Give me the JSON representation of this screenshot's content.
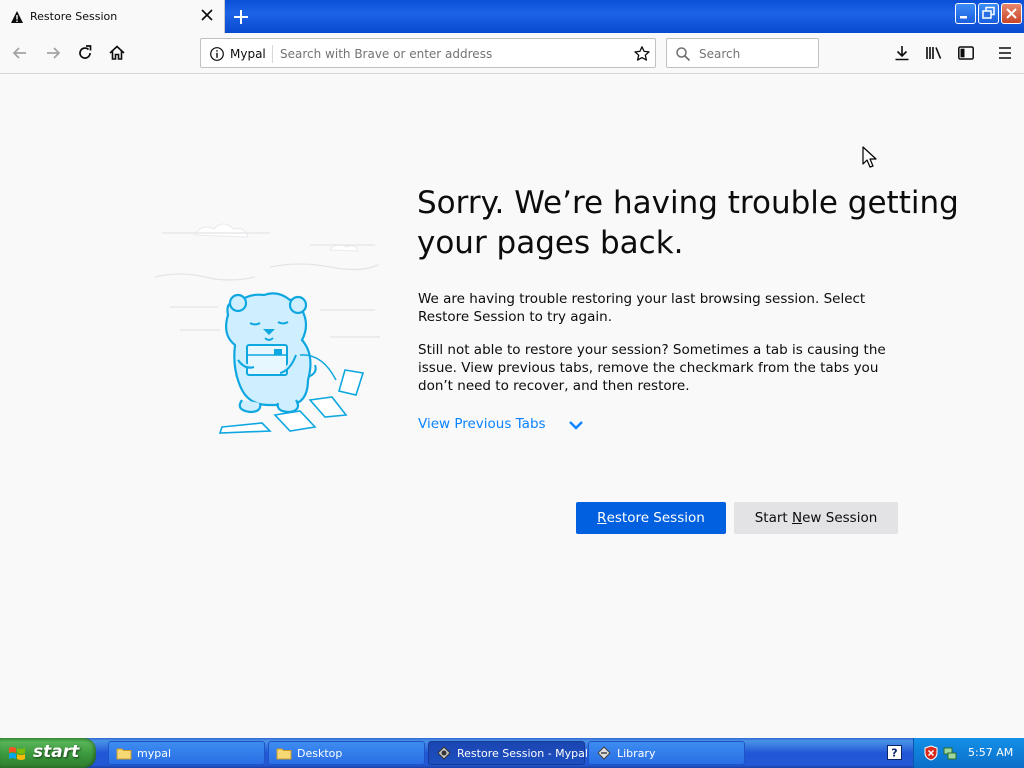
{
  "browser": {
    "tab": {
      "title": "Restore Session",
      "icon": "warning-icon"
    },
    "address": {
      "site_name": "Mypal",
      "placeholder": "Search with Brave or enter address"
    },
    "search": {
      "placeholder": "Search"
    }
  },
  "content": {
    "headline": "Sorry. We’re having trouble getting your pages back.",
    "paragraph1": "We are having trouble restoring your last browsing session. Select Restore Session to try again.",
    "paragraph2": "Still not able to restore your session? Sometimes a tab is causing the issue. View previous tabs, remove the checkmark from the tabs you don’t need to recover, and then restore.",
    "view_previous_tabs": "View Previous Tabs",
    "restore_button": {
      "underlined": "R",
      "rest": "estore Session"
    },
    "new_session_button": {
      "before": "Start ",
      "underlined": "N",
      "after": "ew Session"
    }
  },
  "colors": {
    "accent": "#0a84ff",
    "primary_button": "#0060df",
    "secondary_button": "#e3e3e6"
  },
  "taskbar": {
    "start_label": "start",
    "tasks": [
      {
        "label": "mypal",
        "icon": "folder-icon"
      },
      {
        "label": "Desktop",
        "icon": "folder-icon"
      },
      {
        "label": "Restore Session - Mypal",
        "icon": "mypal-icon"
      },
      {
        "label": "Library",
        "icon": "library-icon"
      }
    ],
    "clock": "5:57 AM"
  }
}
